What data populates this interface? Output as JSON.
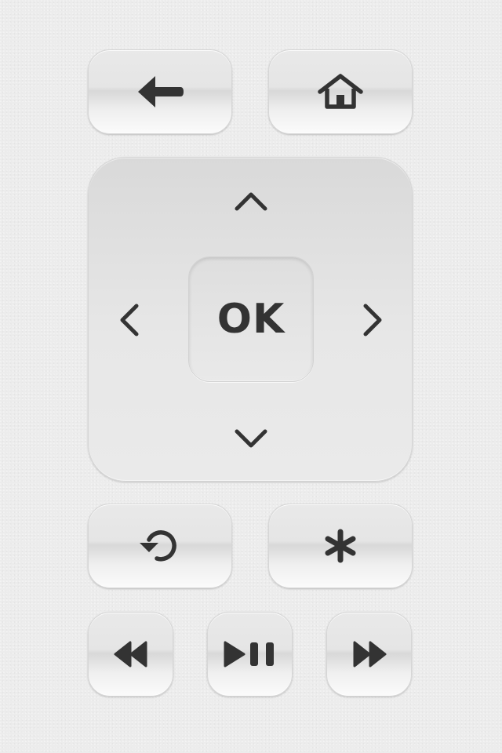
{
  "remote": {
    "top_row": {
      "back": {
        "icon": "back-arrow-icon"
      },
      "home": {
        "icon": "home-icon"
      }
    },
    "dpad": {
      "up": {
        "icon": "chevron-up-icon"
      },
      "down": {
        "icon": "chevron-down-icon"
      },
      "left": {
        "icon": "chevron-left-icon"
      },
      "right": {
        "icon": "chevron-right-icon"
      },
      "ok_label": "OK"
    },
    "middle_row": {
      "replay": {
        "icon": "instant-replay-icon"
      },
      "options": {
        "icon": "asterisk-icon"
      }
    },
    "playback_row": {
      "rewind": {
        "icon": "rewind-icon"
      },
      "play_pause": {
        "icon": "play-pause-icon"
      },
      "fast_forward": {
        "icon": "fast-forward-icon"
      }
    }
  },
  "colors": {
    "background": "#ececec",
    "button_face": "#e6e6e6",
    "icon": "#333333"
  }
}
